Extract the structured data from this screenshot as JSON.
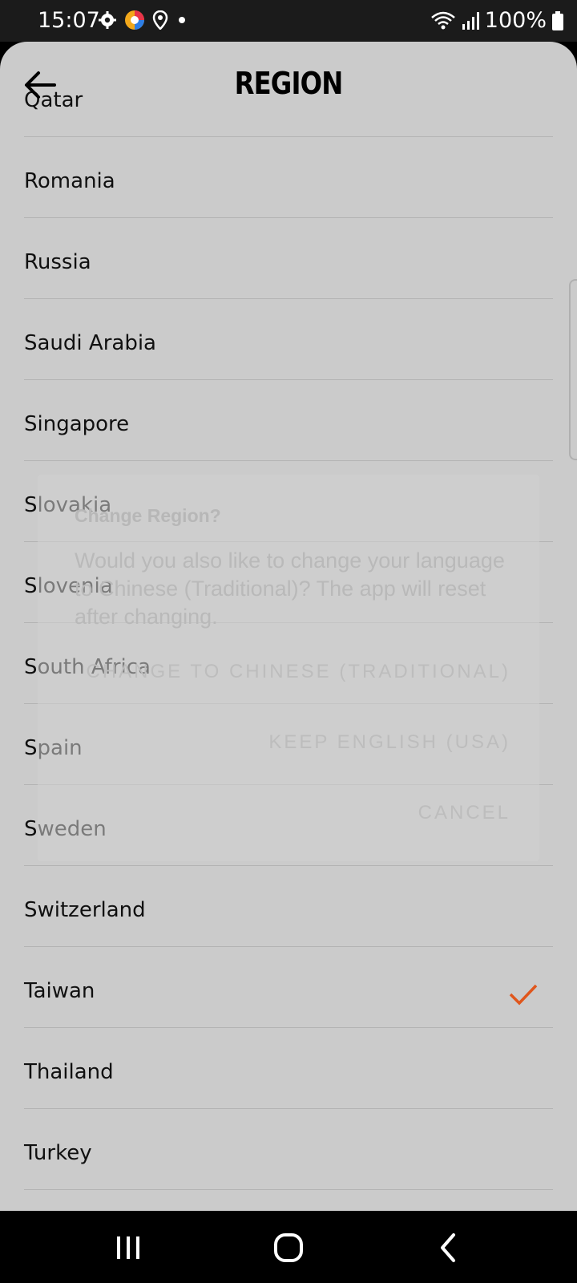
{
  "status": {
    "time": "15:07",
    "battery": "100%"
  },
  "header": {
    "title": "REGION"
  },
  "regions": [
    {
      "name": "Qatar",
      "selected": false
    },
    {
      "name": "Romania",
      "selected": false
    },
    {
      "name": "Russia",
      "selected": false
    },
    {
      "name": "Saudi Arabia",
      "selected": false
    },
    {
      "name": "Singapore",
      "selected": false
    },
    {
      "name": "Slovakia",
      "selected": false
    },
    {
      "name": "Slovenia",
      "selected": false
    },
    {
      "name": "South Africa",
      "selected": false
    },
    {
      "name": "Spain",
      "selected": false
    },
    {
      "name": "Sweden",
      "selected": false
    },
    {
      "name": "Switzerland",
      "selected": false
    },
    {
      "name": "Taiwan",
      "selected": true
    },
    {
      "name": "Thailand",
      "selected": false
    },
    {
      "name": "Turkey",
      "selected": false
    }
  ],
  "dialog": {
    "title": "Change Region?",
    "message": "Would you also like to change your language to Chinese (Traditional)? The app will reset after changing.",
    "change_label": "CHANGE TO CHINESE (TRADITIONAL)",
    "keep_label": "KEEP ENGLISH (USA)",
    "cancel_label": "CANCEL"
  },
  "colors": {
    "accent": "#e0561c",
    "sheet": "#cbcbcb"
  }
}
